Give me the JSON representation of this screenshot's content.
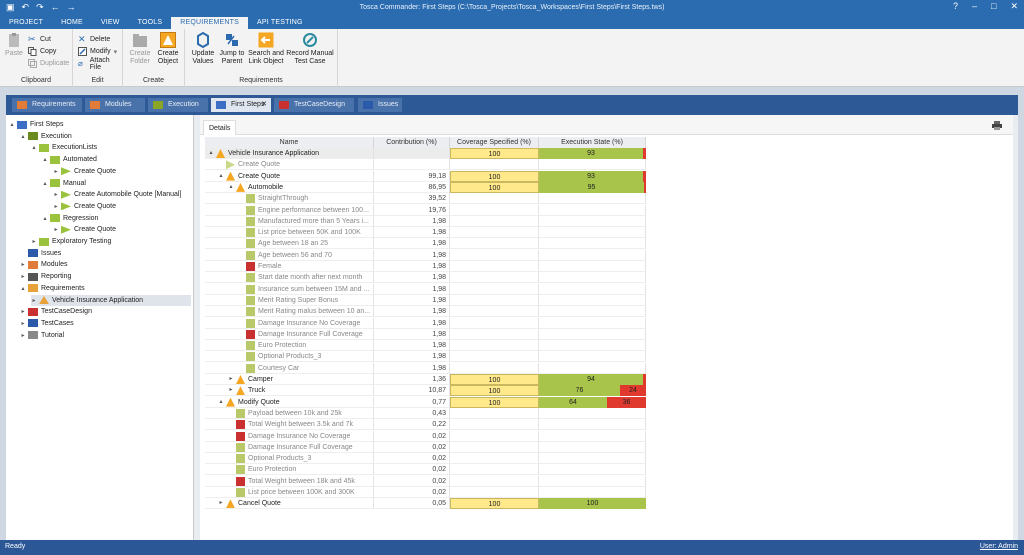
{
  "window": {
    "title": "Tosca Commander: First Steps (C:\\Tosca_Projects\\Tosca_Workspaces\\First Steps\\First Steps.tws)"
  },
  "menu": {
    "tabs": [
      {
        "label": "PROJECT"
      },
      {
        "label": "HOME"
      },
      {
        "label": "VIEW"
      },
      {
        "label": "TOOLS"
      },
      {
        "label": "REQUIREMENTS"
      },
      {
        "label": "API TESTING"
      }
    ]
  },
  "ribbon": {
    "clipboard": {
      "label": "Clipboard",
      "paste": "Paste",
      "cut": "Cut",
      "copy": "Copy",
      "duplicate": "Duplicate"
    },
    "edit": {
      "label": "Edit",
      "delete": "Delete",
      "modify": "Modify",
      "attach": "Attach File"
    },
    "create": {
      "label": "Create",
      "folder": "Create Folder",
      "object": "Create Object"
    },
    "requirements": {
      "label": "Requirements",
      "update": "Update Values",
      "jump": "Jump to Parent",
      "search": "Search and Link Object",
      "record": "Record Manual Test Case"
    }
  },
  "doc_tabs": [
    {
      "label": "Requirements",
      "color": "#e07b39"
    },
    {
      "label": "Modules",
      "color": "#e07b39"
    },
    {
      "label": "Execution",
      "color": "#8aa624"
    },
    {
      "label": "First Steps",
      "color": "#3b6ec4"
    },
    {
      "label": "TestCaseDesign",
      "color": "#c8312f"
    },
    {
      "label": "Issues",
      "color": "#2a5aa8"
    }
  ],
  "tree": [
    {
      "label": "First Steps",
      "level": 0,
      "arrow": "▴",
      "icon": "project",
      "color": "#3b6ec4"
    },
    {
      "label": "Execution",
      "level": 1,
      "arrow": "▴",
      "icon": "folder",
      "color": "#6b8a1e"
    },
    {
      "label": "ExecutionLists",
      "level": 2,
      "arrow": "▴",
      "icon": "folder",
      "color": "#9bc23c"
    },
    {
      "label": "Automated",
      "level": 3,
      "arrow": "▴",
      "icon": "folder",
      "color": "#9bc23c"
    },
    {
      "label": "Create Quote",
      "level": 4,
      "arrow": "▸",
      "icon": "exec",
      "color": "#9bc23c"
    },
    {
      "label": "Manual",
      "level": 3,
      "arrow": "▴",
      "icon": "folder",
      "color": "#9bc23c"
    },
    {
      "label": "Create Automobile Quote [Manual]",
      "level": 4,
      "arrow": "▸",
      "icon": "exec",
      "color": "#9bc23c"
    },
    {
      "label": "Create Quote",
      "level": 4,
      "arrow": "▸",
      "icon": "exec",
      "color": "#9bc23c"
    },
    {
      "label": "Regression",
      "level": 3,
      "arrow": "▴",
      "icon": "folder",
      "color": "#9bc23c"
    },
    {
      "label": "Create Quote",
      "level": 4,
      "arrow": "▸",
      "icon": "exec",
      "color": "#9bc23c"
    },
    {
      "label": "Exploratory Testing",
      "level": 2,
      "arrow": "▸",
      "icon": "explore",
      "color": "#9bc23c"
    },
    {
      "label": "Issues",
      "level": 1,
      "arrow": "",
      "icon": "folder",
      "color": "#2a5aa8"
    },
    {
      "label": "Modules",
      "level": 1,
      "arrow": "▸",
      "icon": "folder",
      "color": "#e07b39"
    },
    {
      "label": "Reporting",
      "level": 1,
      "arrow": "▸",
      "icon": "report",
      "color": "#555555"
    },
    {
      "label": "Requirements",
      "level": 1,
      "arrow": "▴",
      "icon": "folder",
      "color": "#e8a23a"
    },
    {
      "label": "Vehicle Insurance Application",
      "level": 2,
      "arrow": "▸",
      "icon": "req",
      "color": "#e8a23a",
      "selected": true
    },
    {
      "label": "TestCaseDesign",
      "level": 1,
      "arrow": "▸",
      "icon": "folder",
      "color": "#c8312f"
    },
    {
      "label": "TestCases",
      "level": 1,
      "arrow": "▸",
      "icon": "folder",
      "color": "#2a5aa8"
    },
    {
      "label": "Tutorial",
      "level": 1,
      "arrow": "▸",
      "icon": "folder",
      "color": "#888888"
    }
  ],
  "details": {
    "tab": "Details",
    "columns": {
      "name": "Name",
      "contribution": "Contribution (%)",
      "coverage": "Coverage Specified (%)",
      "execution": "Execution State (%)"
    },
    "rows": [
      {
        "name": "Vehicle Insurance Application",
        "indent": 0,
        "arrow": "▴",
        "icon": "req",
        "contribution": "",
        "coverage": "100",
        "exec_green": 93,
        "exec_red": "",
        "exec_red_w": 3,
        "sum": true
      },
      {
        "name": "Create Quote",
        "indent": 1,
        "arrow": "",
        "icon": "tc",
        "contribution": "",
        "coverage": "",
        "exec_green": null,
        "grey": true
      },
      {
        "name": "Create Quote",
        "indent": 1,
        "arrow": "▴",
        "icon": "req",
        "contribution": "99,18",
        "coverage": "100",
        "exec_green": 93,
        "exec_red": "",
        "exec_red_w": 3
      },
      {
        "name": "Automobile",
        "indent": 2,
        "arrow": "▴",
        "icon": "req",
        "contribution": "86,95",
        "coverage": "100",
        "exec_green": 95,
        "exec_red": "",
        "exec_red_w": 2
      },
      {
        "name": "StraightThrough",
        "indent": 3,
        "arrow": "",
        "icon": "tcg",
        "contribution": "39,52",
        "grey": true
      },
      {
        "name": "Engine performance between 100...",
        "indent": 3,
        "arrow": "",
        "icon": "tcg",
        "contribution": "19,76",
        "grey": true
      },
      {
        "name": "Manufactured more than 5 Years i...",
        "indent": 3,
        "arrow": "",
        "icon": "tcg",
        "contribution": "1,98",
        "grey": true
      },
      {
        "name": "List price between 50K and 100K",
        "indent": 3,
        "arrow": "",
        "icon": "tcg",
        "contribution": "1,98",
        "grey": true
      },
      {
        "name": "Age between 18 an 25",
        "indent": 3,
        "arrow": "",
        "icon": "tcg",
        "contribution": "1,98",
        "grey": true
      },
      {
        "name": "Age between 56 and 70",
        "indent": 3,
        "arrow": "",
        "icon": "tcg",
        "contribution": "1,98",
        "grey": true
      },
      {
        "name": "Female",
        "indent": 3,
        "arrow": "",
        "icon": "tcr",
        "contribution": "1,98",
        "grey": true
      },
      {
        "name": "Start date month after next month",
        "indent": 3,
        "arrow": "",
        "icon": "tcg",
        "contribution": "1,98",
        "grey": true
      },
      {
        "name": "Insurance sum between 15M and ...",
        "indent": 3,
        "arrow": "",
        "icon": "tcg",
        "contribution": "1,98",
        "grey": true
      },
      {
        "name": "Merit Rating Super Bonus",
        "indent": 3,
        "arrow": "",
        "icon": "tcg",
        "contribution": "1,98",
        "grey": true
      },
      {
        "name": "Merit Rating malus between 10 an...",
        "indent": 3,
        "arrow": "",
        "icon": "tcg",
        "contribution": "1,98",
        "grey": true
      },
      {
        "name": "Damage Insurance No Coverage",
        "indent": 3,
        "arrow": "",
        "icon": "tcg",
        "contribution": "1,98",
        "grey": true
      },
      {
        "name": "Damage Insurance Full Coverage",
        "indent": 3,
        "arrow": "",
        "icon": "tcr",
        "contribution": "1,98",
        "grey": true
      },
      {
        "name": "Euro Protection",
        "indent": 3,
        "arrow": "",
        "icon": "tcg",
        "contribution": "1,98",
        "grey": true
      },
      {
        "name": "Optional Products_3",
        "indent": 3,
        "arrow": "",
        "icon": "tcg",
        "contribution": "1,98",
        "grey": true
      },
      {
        "name": "Courtesy Car",
        "indent": 3,
        "arrow": "",
        "icon": "tcg",
        "contribution": "1,98",
        "grey": true
      },
      {
        "name": "Camper",
        "indent": 2,
        "arrow": "▸",
        "icon": "req",
        "contribution": "1,36",
        "coverage": "100",
        "exec_green": 94,
        "exec_red": "",
        "exec_red_w": 3
      },
      {
        "name": "Truck",
        "indent": 2,
        "arrow": "▸",
        "icon": "req",
        "contribution": "10,87",
        "coverage": "100",
        "exec_green": 76,
        "exec_red": "24",
        "exec_red_w": 24
      },
      {
        "name": "Modify Quote",
        "indent": 1,
        "arrow": "▴",
        "icon": "req",
        "contribution": "0,77",
        "coverage": "100",
        "exec_green": 64,
        "exec_red": "36",
        "exec_red_w": 36
      },
      {
        "name": "Payload between 10k and 25k",
        "indent": 2,
        "arrow": "",
        "icon": "tcg",
        "contribution": "0,43",
        "grey": true
      },
      {
        "name": "Total Weight between 3.5k and 7k",
        "indent": 2,
        "arrow": "",
        "icon": "tcr",
        "contribution": "0,22",
        "grey": true
      },
      {
        "name": "Damage Insurance No Coverage",
        "indent": 2,
        "arrow": "",
        "icon": "tcr",
        "contribution": "0,02",
        "grey": true
      },
      {
        "name": "Damage Insurance Full Coverage",
        "indent": 2,
        "arrow": "",
        "icon": "tcg",
        "contribution": "0,02",
        "grey": true
      },
      {
        "name": "Optional Products_3",
        "indent": 2,
        "arrow": "",
        "icon": "tcg",
        "contribution": "0,02",
        "grey": true
      },
      {
        "name": "Euro Protection",
        "indent": 2,
        "arrow": "",
        "icon": "tcg",
        "contribution": "0,02",
        "grey": true
      },
      {
        "name": "Total Weight between 18k and 45k",
        "indent": 2,
        "arrow": "",
        "icon": "tcr",
        "contribution": "0,02",
        "grey": true
      },
      {
        "name": "List price between 100K and 300K",
        "indent": 2,
        "arrow": "",
        "icon": "tcg",
        "contribution": "0,02",
        "grey": true
      },
      {
        "name": "Cancel Quote",
        "indent": 1,
        "arrow": "▸",
        "icon": "req",
        "contribution": "0,05",
        "coverage": "100",
        "exec_green": 100,
        "exec_label": "100",
        "exec_red": "",
        "exec_red_w": 0
      }
    ]
  },
  "status": {
    "left": "Ready",
    "right": "User: Admin"
  }
}
